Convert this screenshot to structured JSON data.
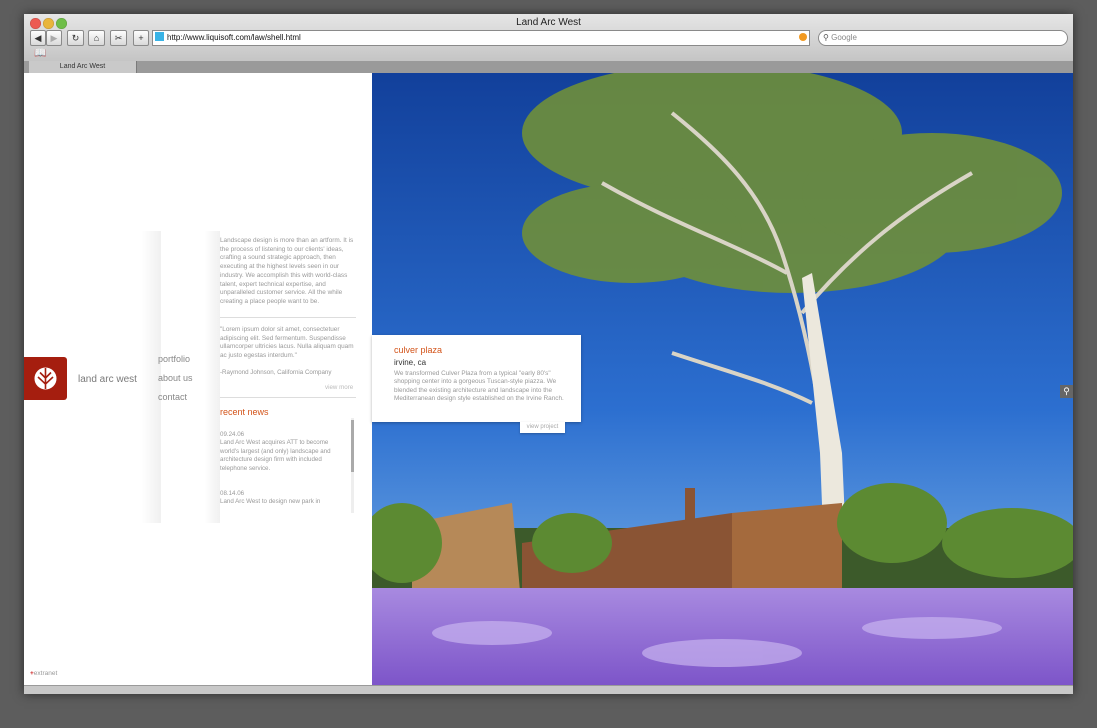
{
  "browser": {
    "window_title": "Land Arc West",
    "url": "http://www.liquisoft.com/law/shell.html",
    "search_placeholder": "Google",
    "tab_label": "Land Arc West"
  },
  "site": {
    "brand": "land arc west",
    "nav": [
      "portfolio",
      "about us",
      "contact"
    ],
    "intro": "Landscape design is more than an artform. It is the process of listening to our clients' ideas, crafting a sound strategic approach, then executing at the highest levels seen in our industry. We accomplish this with world-class talent, expert technical expertise, and unparalleled customer service. All the while creating a place people want to be.",
    "quote": "\"Lorem ipsum dolor sit amet, consectetuer adipiscing elit. Sed fermentum. Suspendisse ullamcorper ultricies lacus. Nulla aliquam quam ac justo egestas interdum.\"",
    "quote_author": "-Raymond Johnson, California Company",
    "view_more": "view more",
    "news_heading": "recent news",
    "news": [
      {
        "date": "09.24.06",
        "text": "Land Arc West acquires ATT to become world's largest (and only) landscape and architecture design firm with included telephone service."
      },
      {
        "date": "08.14.06",
        "text": "Land Arc West to design new park in"
      }
    ],
    "extranet": "extranet",
    "project": {
      "title": "culver plaza",
      "location": "irvine, ca",
      "description": "We transformed Culver Plaza from a typical \"early 80's\" shopping center into a gorgeous Tuscan-style piazza. We blended the existing architecture and landscape into the Mediterranean design style established on the Irvine Ranch.",
      "link": "view project"
    }
  },
  "colors": {
    "accent": "#d3541a",
    "logo": "#a51e0f",
    "sky": "#1d58b8",
    "flowers": "#9c74d6"
  }
}
